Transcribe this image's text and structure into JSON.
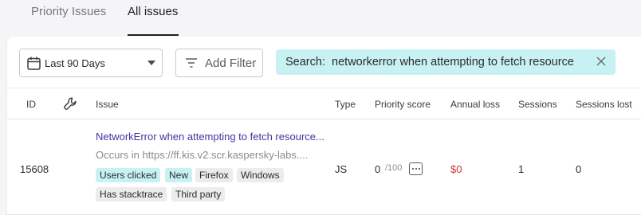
{
  "tabs": [
    {
      "label": "Priority Issues",
      "active": false
    },
    {
      "label": "All issues",
      "active": true
    }
  ],
  "filters": {
    "date_range": "Last 90 Days",
    "add_filter": "Add Filter",
    "search_prefix": "Search:",
    "search_query": "networkerror when attempting to fetch resource"
  },
  "table": {
    "columns": [
      "ID",
      "Issue",
      "Type",
      "Priority score",
      "Annual loss",
      "Sessions",
      "Sessions lost"
    ],
    "wrench_icon": "wrench-icon",
    "rows": [
      {
        "id": "15608",
        "title": "NetworkError when attempting to fetch resource...",
        "subtitle": "Occurs in https://ff.kis.v2.scr.kaspersky-labs....",
        "tags": [
          "Users clicked",
          "New",
          "Firefox",
          "Windows",
          "Has stacktrace",
          "Third party"
        ],
        "type": "JS",
        "priority": "0",
        "priority_max": "/100",
        "annual_loss": "$0",
        "sessions": "1",
        "sessions_lost": "0"
      }
    ]
  },
  "colors": {
    "accent_link": "#4b2fa0",
    "chip_teal": "#c8f1f4",
    "loss_red": "#d02f2f"
  }
}
